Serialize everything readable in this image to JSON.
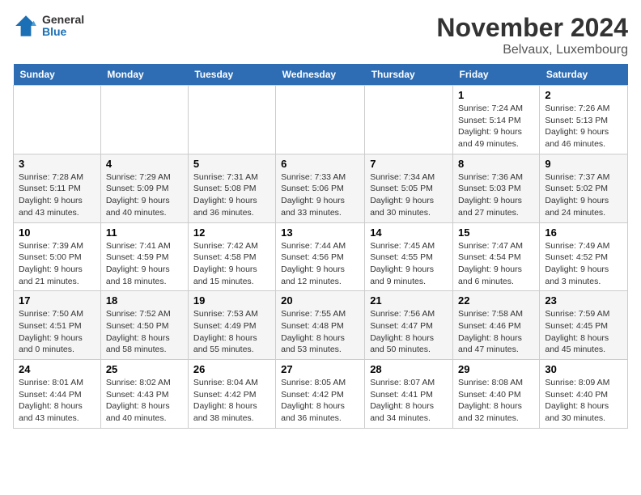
{
  "logo": {
    "general": "General",
    "blue": "Blue"
  },
  "title": "November 2024",
  "location": "Belvaux, Luxembourg",
  "days_header": [
    "Sunday",
    "Monday",
    "Tuesday",
    "Wednesday",
    "Thursday",
    "Friday",
    "Saturday"
  ],
  "weeks": [
    [
      {
        "day": "",
        "info": ""
      },
      {
        "day": "",
        "info": ""
      },
      {
        "day": "",
        "info": ""
      },
      {
        "day": "",
        "info": ""
      },
      {
        "day": "",
        "info": ""
      },
      {
        "day": "1",
        "info": "Sunrise: 7:24 AM\nSunset: 5:14 PM\nDaylight: 9 hours and 49 minutes."
      },
      {
        "day": "2",
        "info": "Sunrise: 7:26 AM\nSunset: 5:13 PM\nDaylight: 9 hours and 46 minutes."
      }
    ],
    [
      {
        "day": "3",
        "info": "Sunrise: 7:28 AM\nSunset: 5:11 PM\nDaylight: 9 hours and 43 minutes."
      },
      {
        "day": "4",
        "info": "Sunrise: 7:29 AM\nSunset: 5:09 PM\nDaylight: 9 hours and 40 minutes."
      },
      {
        "day": "5",
        "info": "Sunrise: 7:31 AM\nSunset: 5:08 PM\nDaylight: 9 hours and 36 minutes."
      },
      {
        "day": "6",
        "info": "Sunrise: 7:33 AM\nSunset: 5:06 PM\nDaylight: 9 hours and 33 minutes."
      },
      {
        "day": "7",
        "info": "Sunrise: 7:34 AM\nSunset: 5:05 PM\nDaylight: 9 hours and 30 minutes."
      },
      {
        "day": "8",
        "info": "Sunrise: 7:36 AM\nSunset: 5:03 PM\nDaylight: 9 hours and 27 minutes."
      },
      {
        "day": "9",
        "info": "Sunrise: 7:37 AM\nSunset: 5:02 PM\nDaylight: 9 hours and 24 minutes."
      }
    ],
    [
      {
        "day": "10",
        "info": "Sunrise: 7:39 AM\nSunset: 5:00 PM\nDaylight: 9 hours and 21 minutes."
      },
      {
        "day": "11",
        "info": "Sunrise: 7:41 AM\nSunset: 4:59 PM\nDaylight: 9 hours and 18 minutes."
      },
      {
        "day": "12",
        "info": "Sunrise: 7:42 AM\nSunset: 4:58 PM\nDaylight: 9 hours and 15 minutes."
      },
      {
        "day": "13",
        "info": "Sunrise: 7:44 AM\nSunset: 4:56 PM\nDaylight: 9 hours and 12 minutes."
      },
      {
        "day": "14",
        "info": "Sunrise: 7:45 AM\nSunset: 4:55 PM\nDaylight: 9 hours and 9 minutes."
      },
      {
        "day": "15",
        "info": "Sunrise: 7:47 AM\nSunset: 4:54 PM\nDaylight: 9 hours and 6 minutes."
      },
      {
        "day": "16",
        "info": "Sunrise: 7:49 AM\nSunset: 4:52 PM\nDaylight: 9 hours and 3 minutes."
      }
    ],
    [
      {
        "day": "17",
        "info": "Sunrise: 7:50 AM\nSunset: 4:51 PM\nDaylight: 9 hours and 0 minutes."
      },
      {
        "day": "18",
        "info": "Sunrise: 7:52 AM\nSunset: 4:50 PM\nDaylight: 8 hours and 58 minutes."
      },
      {
        "day": "19",
        "info": "Sunrise: 7:53 AM\nSunset: 4:49 PM\nDaylight: 8 hours and 55 minutes."
      },
      {
        "day": "20",
        "info": "Sunrise: 7:55 AM\nSunset: 4:48 PM\nDaylight: 8 hours and 53 minutes."
      },
      {
        "day": "21",
        "info": "Sunrise: 7:56 AM\nSunset: 4:47 PM\nDaylight: 8 hours and 50 minutes."
      },
      {
        "day": "22",
        "info": "Sunrise: 7:58 AM\nSunset: 4:46 PM\nDaylight: 8 hours and 47 minutes."
      },
      {
        "day": "23",
        "info": "Sunrise: 7:59 AM\nSunset: 4:45 PM\nDaylight: 8 hours and 45 minutes."
      }
    ],
    [
      {
        "day": "24",
        "info": "Sunrise: 8:01 AM\nSunset: 4:44 PM\nDaylight: 8 hours and 43 minutes."
      },
      {
        "day": "25",
        "info": "Sunrise: 8:02 AM\nSunset: 4:43 PM\nDaylight: 8 hours and 40 minutes."
      },
      {
        "day": "26",
        "info": "Sunrise: 8:04 AM\nSunset: 4:42 PM\nDaylight: 8 hours and 38 minutes."
      },
      {
        "day": "27",
        "info": "Sunrise: 8:05 AM\nSunset: 4:42 PM\nDaylight: 8 hours and 36 minutes."
      },
      {
        "day": "28",
        "info": "Sunrise: 8:07 AM\nSunset: 4:41 PM\nDaylight: 8 hours and 34 minutes."
      },
      {
        "day": "29",
        "info": "Sunrise: 8:08 AM\nSunset: 4:40 PM\nDaylight: 8 hours and 32 minutes."
      },
      {
        "day": "30",
        "info": "Sunrise: 8:09 AM\nSunset: 4:40 PM\nDaylight: 8 hours and 30 minutes."
      }
    ]
  ]
}
